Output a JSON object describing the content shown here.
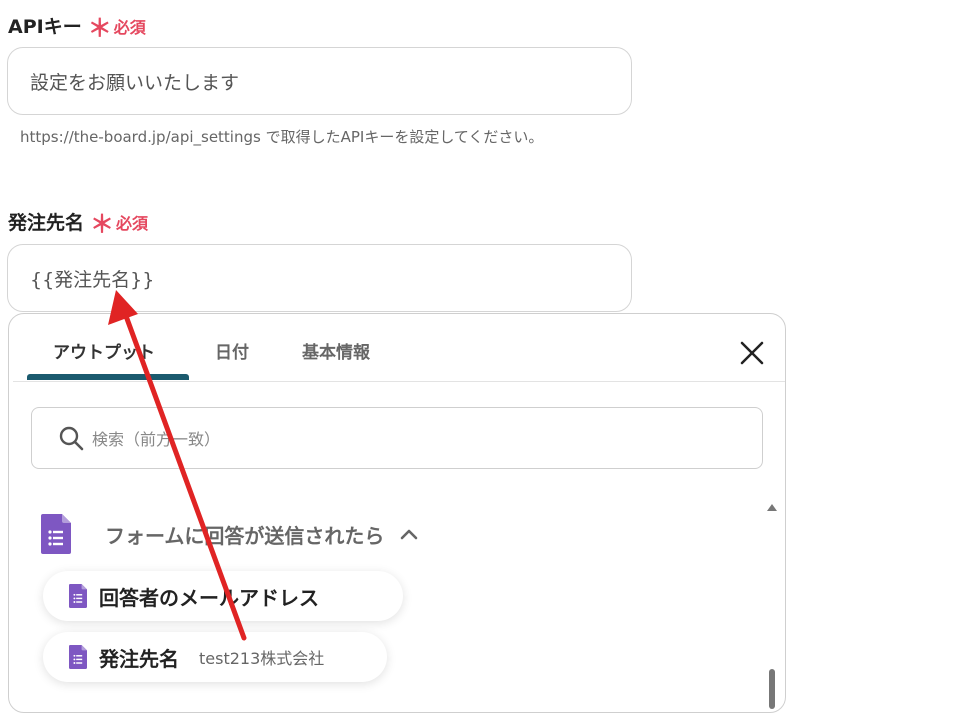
{
  "fields": [
    {
      "label": "APIキー",
      "required_star": "＊",
      "required_text": "必須",
      "value": "設定をお願いいたします",
      "help": "https://the-board.jp/api_settings で取得したAPIキーを設定してください。"
    },
    {
      "label": "発注先名",
      "required_star": "＊",
      "required_text": "必須",
      "value": "{{発注先名}}"
    }
  ],
  "panel": {
    "tabs": [
      {
        "label": "アウトプット",
        "active": true
      },
      {
        "label": "日付",
        "active": false
      },
      {
        "label": "基本情報",
        "active": false
      }
    ],
    "search_placeholder": "検索（前方一致）",
    "section_title": "フォームに回答が送信されたら",
    "items": [
      {
        "label": "回答者のメールアドレス",
        "value": ""
      },
      {
        "label": "発注先名",
        "value": "test213株式会社"
      }
    ]
  },
  "colors": {
    "required": "#e5485f",
    "tab_indicator": "#1b5a6e",
    "forms_icon": "#7e57c2",
    "arrow": "#e02424"
  },
  "icons": [
    "search-icon",
    "close-icon",
    "chevron-up-icon",
    "google-forms-icon"
  ]
}
